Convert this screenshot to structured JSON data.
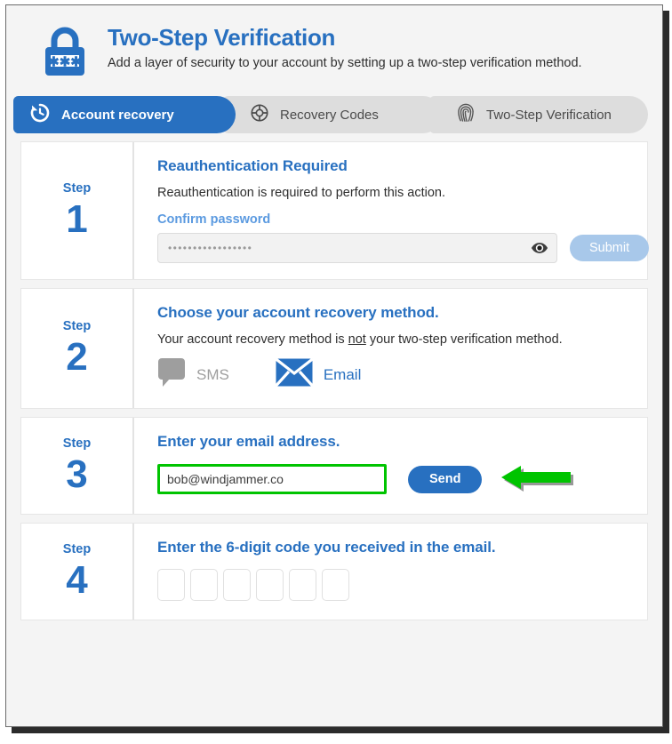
{
  "header": {
    "icon": "padlock-asterisks-icon",
    "title": "Two-Step Verification",
    "subtitle": "Add a layer of security to your account by setting up a two-step verification method."
  },
  "tabs": [
    {
      "id": "account-recovery",
      "label": "Account recovery",
      "icon": "restore-clock-icon",
      "active": true
    },
    {
      "id": "recovery-codes",
      "label": "Recovery Codes",
      "icon": "lifebuoy-icon",
      "active": false
    },
    {
      "id": "two-step-verification",
      "label": "Two-Step Verification",
      "icon": "fingerprint-icon",
      "active": false
    }
  ],
  "steps": [
    {
      "step_word": "Step",
      "step_number": "1",
      "heading": "Reauthentication Required",
      "text": "Reauthentication is required to perform this action.",
      "field_label": "Confirm password",
      "password_value": "•••••••••••••••••",
      "password_placeholder": "",
      "eye_icon": "eye-icon",
      "submit_label": "Submit"
    },
    {
      "step_word": "Step",
      "step_number": "2",
      "heading": "Choose your account recovery method.",
      "text_before": "Your account recovery method is ",
      "text_emphasis": "not",
      "text_after": " your two-step verification method.",
      "methods": [
        {
          "id": "sms",
          "label": "SMS",
          "icon": "speech-bubble-icon",
          "enabled": false
        },
        {
          "id": "email",
          "label": "Email",
          "icon": "envelope-icon",
          "enabled": true
        }
      ]
    },
    {
      "step_word": "Step",
      "step_number": "3",
      "heading": "Enter your email address.",
      "email_value": "bob@windjammer.co",
      "email_placeholder": "",
      "send_label": "Send",
      "annotation_icon": "green-left-arrow-icon"
    },
    {
      "step_word": "Step",
      "step_number": "4",
      "heading": "Enter the 6-digit code you received in the email.",
      "code_digits": [
        "",
        "",
        "",
        "",
        "",
        ""
      ]
    }
  ],
  "colors": {
    "brand_blue": "#2870c0",
    "disabled_blue": "#a8c8ea",
    "annotation_green": "#00c400",
    "tab_inactive": "#dddddd",
    "muted_gray": "#9e9e9e"
  }
}
